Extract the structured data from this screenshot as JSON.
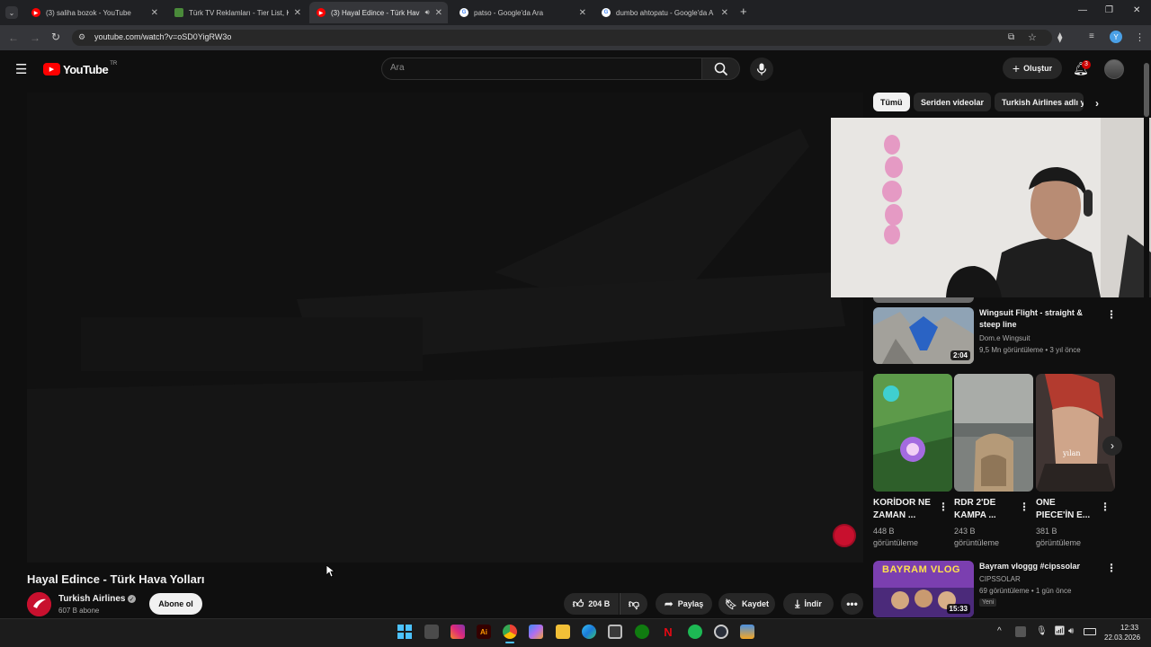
{
  "browser": {
    "tabs": [
      {
        "title": "(3) saliha bozok - YouTube",
        "icon": "youtube-icon",
        "active": false
      },
      {
        "title": "Türk TV Reklamları - Tier List, K",
        "icon": "tierlist-icon",
        "active": false
      },
      {
        "title": "(3) Hayal Edince - Türk Hav",
        "icon": "youtube-icon",
        "active": true
      },
      {
        "title": "patso - Google'da Ara",
        "icon": "google-icon",
        "active": false
      },
      {
        "title": "dumbo ahtopatu - Google'da A",
        "icon": "google-icon",
        "active": false
      }
    ],
    "url": "youtube.com/watch?v=oSD0YigRW3o"
  },
  "youtube": {
    "logo_text": "YouTube",
    "region": "TR",
    "search_placeholder": "Ara",
    "create_label": "Oluştur",
    "notification_count": "3"
  },
  "video": {
    "title": "Hayal Edince - Türk Hava Yolları",
    "channel": "Turkish Airlines",
    "subscribers": "607 B abone",
    "subscribe_label": "Abone ol",
    "likes": "204 B",
    "share_label": "Paylaş",
    "save_label": "Kaydet",
    "download_label": "İndir"
  },
  "chips": [
    "Tümü",
    "Seriden videolar",
    "Turkish Airlines adlı y"
  ],
  "recommendations": [
    {
      "title_lines": [
        "Wingsuit Flight - straight &",
        "steep line"
      ],
      "channel": "Dom.e Wingsuit",
      "meta": "9,5 Mn görüntüleme • 3 yıl önce",
      "duration": "2:04"
    },
    {
      "title_lines": [
        "Bayram vloggg #cipssolar"
      ],
      "channel": "CIPSSOLAR",
      "meta": "69 görüntüleme • 1 gün önce",
      "duration": "15:33",
      "badge": "Yeni",
      "thumb_text": "BAYRAM VLOG"
    }
  ],
  "shorts": [
    {
      "title_lines": [
        "KORİDOR NE",
        "ZAMAN ..."
      ],
      "views": "448 B",
      "views_label": "görüntüleme"
    },
    {
      "title_lines": [
        "RDR 2'DE",
        "KAMPA ..."
      ],
      "views": "243 B",
      "views_label": "görüntüleme"
    },
    {
      "title_lines": [
        "ONE",
        "PIECE'İN E..."
      ],
      "views": "381 B",
      "views_label": "görüntüleme",
      "thumb_text": "yılan"
    }
  ],
  "taskbar": {
    "time": "12:33",
    "date": "22.03.2026"
  },
  "colors": {
    "youtube_red": "#ff0000",
    "background": "#0f0f0f",
    "chip_selected": "#f1f1f1"
  }
}
